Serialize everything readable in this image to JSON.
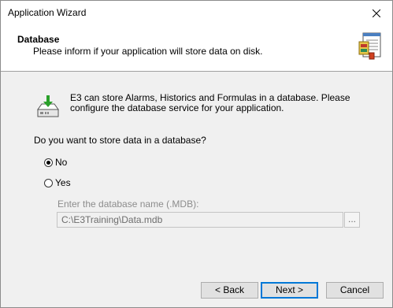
{
  "window": {
    "title": "Application Wizard"
  },
  "header": {
    "title": "Database",
    "subtitle": "Please inform if your application will store data on disk."
  },
  "info": {
    "text": "E3 can store Alarms, Historics and Formulas in a database. Please configure the database service for your application."
  },
  "question": "Do you want to store data in a database?",
  "options": {
    "no_label": "No",
    "yes_label": "Yes",
    "selected": "No"
  },
  "database": {
    "label": "Enter the database name (.MDB):",
    "value": "C:\\E3Training\\Data.mdb",
    "browse_label": "..."
  },
  "buttons": {
    "back": "< Back",
    "next": "Next >",
    "cancel": "Cancel"
  }
}
